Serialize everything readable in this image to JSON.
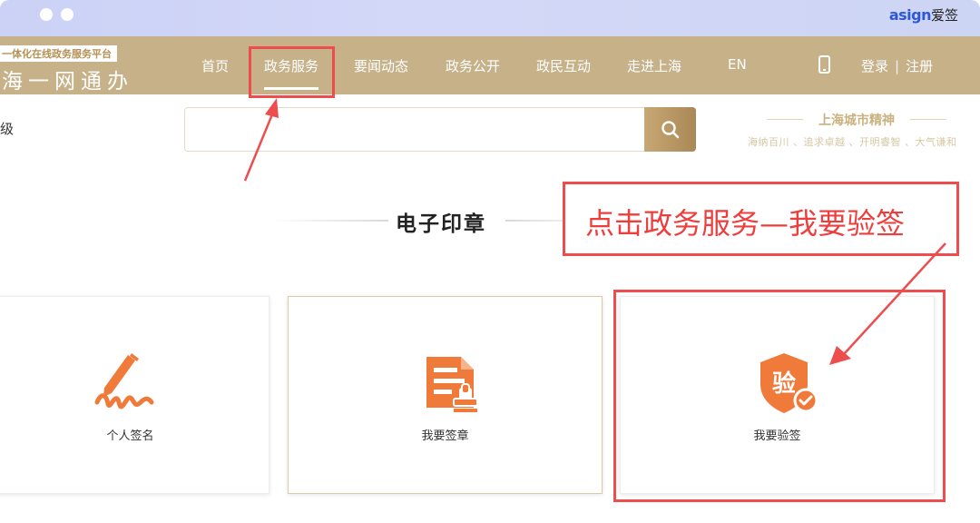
{
  "window": {
    "brand_prefix": "asign",
    "brand_suffix": "爱签"
  },
  "nav": {
    "logo_top": "一体化在线政务服务平台",
    "logo_bottom": "海一网通办",
    "items": [
      {
        "label": "首页"
      },
      {
        "label": "政务服务"
      },
      {
        "label": "要闻动态"
      },
      {
        "label": "政务公开"
      },
      {
        "label": "政民互动"
      },
      {
        "label": "走进上海"
      },
      {
        "label": "EN"
      }
    ],
    "active_item": "政务服务",
    "login": "登录",
    "register": "注册",
    "separator": "|"
  },
  "sub": {
    "level_text": "级",
    "search_placeholder": "",
    "spirit_title": "上海城市精神",
    "spirit_motto": "海纳百川 、追求卓越 、开明睿智 、大气谦和"
  },
  "section": {
    "title": "电子印章"
  },
  "annotation": {
    "text": "点击政务服务—我要验签"
  },
  "cards": [
    {
      "label": "个人签名",
      "icon": "signature-pen-icon"
    },
    {
      "label": "我要签章",
      "icon": "document-stamp-icon"
    },
    {
      "label": "我要验签",
      "icon": "verify-shield-icon",
      "icon_text": "验"
    }
  ],
  "colors": {
    "nav_bg": "#c6b189",
    "accent_orange": "#f07a3a",
    "annotation_red": "#ee4d4d",
    "gold": "#b58f53"
  }
}
